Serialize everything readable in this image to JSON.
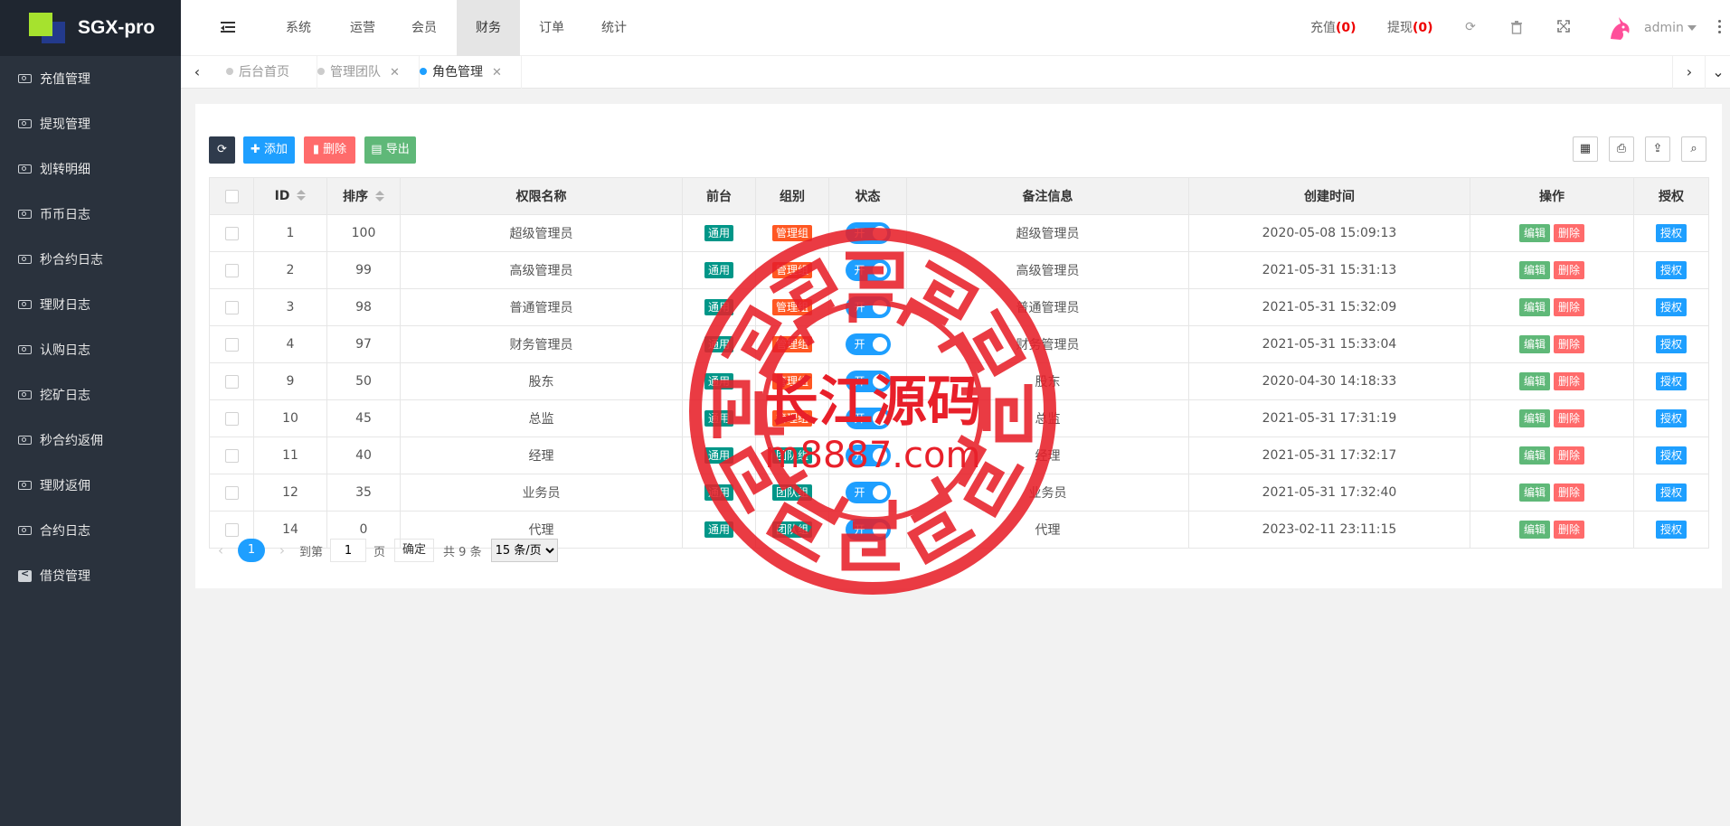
{
  "app": {
    "name": "SGX-pro"
  },
  "sidebar": {
    "items": [
      {
        "label": "充值管理",
        "icon": "money-icon"
      },
      {
        "label": "提现管理",
        "icon": "money-icon"
      },
      {
        "label": "划转明细",
        "icon": "money-icon"
      },
      {
        "label": "币币日志",
        "icon": "money-icon"
      },
      {
        "label": "秒合约日志",
        "icon": "money-icon"
      },
      {
        "label": "理财日志",
        "icon": "money-icon"
      },
      {
        "label": "认购日志",
        "icon": "money-icon"
      },
      {
        "label": "挖矿日志",
        "icon": "money-icon"
      },
      {
        "label": "秒合约返佣",
        "icon": "money-icon"
      },
      {
        "label": "理财返佣",
        "icon": "money-icon"
      },
      {
        "label": "合约日志",
        "icon": "money-icon"
      },
      {
        "label": "借贷管理",
        "icon": "share-icon"
      }
    ]
  },
  "header": {
    "tabs": [
      "系统",
      "运营",
      "会员",
      "财务",
      "订单",
      "统计"
    ],
    "active_tab": "财务",
    "recharge_label": "充值",
    "recharge_count": "(0)",
    "withdraw_label": "提现",
    "withdraw_count": "(0)",
    "user": "admin"
  },
  "page_tabs": [
    {
      "label": "后台首页",
      "closable": false
    },
    {
      "label": "管理团队",
      "closable": true
    },
    {
      "label": "角色管理",
      "closable": true,
      "active": true
    }
  ],
  "toolbar": {
    "add_label": "添加",
    "delete_label": "删除",
    "export_label": "导出"
  },
  "table": {
    "headers": [
      "ID",
      "排序",
      "权限名称",
      "前台",
      "组别",
      "状态",
      "备注信息",
      "创建时间",
      "操作",
      "授权"
    ],
    "rows": [
      {
        "id": "1",
        "sort": "100",
        "name": "超级管理员",
        "front": "通用",
        "group": "管理组",
        "status": "开",
        "remark": "超级管理员",
        "created": "2020-05-08 15:09:13"
      },
      {
        "id": "2",
        "sort": "99",
        "name": "高级管理员",
        "front": "通用",
        "group": "管理组",
        "status": "开",
        "remark": "高级管理员",
        "created": "2021-05-31 15:31:13"
      },
      {
        "id": "3",
        "sort": "98",
        "name": "普通管理员",
        "front": "通用",
        "group": "管理组",
        "status": "开",
        "remark": "普通管理员",
        "created": "2021-05-31 15:32:09"
      },
      {
        "id": "4",
        "sort": "97",
        "name": "财务管理员",
        "front": "通用",
        "group": "管理组",
        "status": "开",
        "remark": "财务管理员",
        "created": "2021-05-31 15:33:04"
      },
      {
        "id": "9",
        "sort": "50",
        "name": "股东",
        "front": "通用",
        "group": "管理组",
        "status": "开",
        "remark": "股东",
        "created": "2020-04-30 14:18:33"
      },
      {
        "id": "10",
        "sort": "45",
        "name": "总监",
        "front": "通用",
        "group": "管理组",
        "status": "开",
        "remark": "总监",
        "created": "2021-05-31 17:31:19"
      },
      {
        "id": "11",
        "sort": "40",
        "name": "经理",
        "front": "通用",
        "group": "团队组",
        "status": "开",
        "remark": "经理",
        "created": "2021-05-31 17:32:17"
      },
      {
        "id": "12",
        "sort": "35",
        "name": "业务员",
        "front": "通用",
        "group": "团队组",
        "status": "开",
        "remark": "业务员",
        "created": "2021-05-31 17:32:40"
      },
      {
        "id": "14",
        "sort": "0",
        "name": "代理",
        "front": "通用",
        "group": "团队组",
        "status": "开",
        "remark": "代理",
        "created": "2023-02-11 23:11:15"
      }
    ],
    "row_actions": {
      "edit": "编辑",
      "delete": "删除",
      "auth": "授权"
    }
  },
  "pagination": {
    "current": "1",
    "goto_label": "到第",
    "page_input": "1",
    "page_unit": "页",
    "confirm": "确定",
    "total": "共 9 条",
    "page_size": "15 条/页"
  },
  "watermark": {
    "title": "长江源码",
    "url": "m8887.com"
  },
  "colors": {
    "sidebar_bg": "#2a323d",
    "primary": "#1e9fff",
    "success": "#5fb878",
    "danger": "#ff6b6b",
    "teal": "#009688",
    "orange": "#ff5722",
    "seal_red": "#e8202a"
  }
}
